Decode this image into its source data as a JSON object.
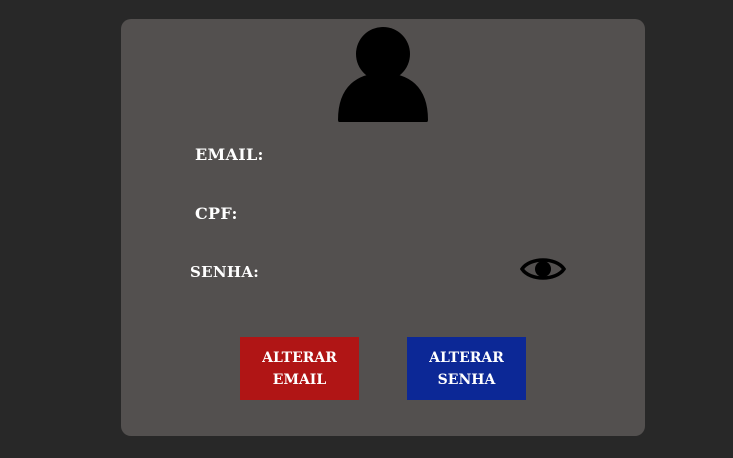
{
  "profile": {
    "avatar_icon": "user-icon",
    "fields": {
      "email_label": "EMAIL:",
      "cpf_label": "CPF:",
      "senha_label": "SENHA:"
    },
    "toggle_password_icon": "eye-icon"
  },
  "actions": {
    "alterar_email": {
      "line1": "ALTERAR",
      "line2": "EMAIL"
    },
    "alterar_senha": {
      "line1": "ALTERAR",
      "line2": "SENHA"
    }
  },
  "colors": {
    "background": "#282828",
    "card": "#53504f",
    "email_button": "#b01515",
    "senha_button": "#0c2896",
    "text": "#ffffff"
  }
}
